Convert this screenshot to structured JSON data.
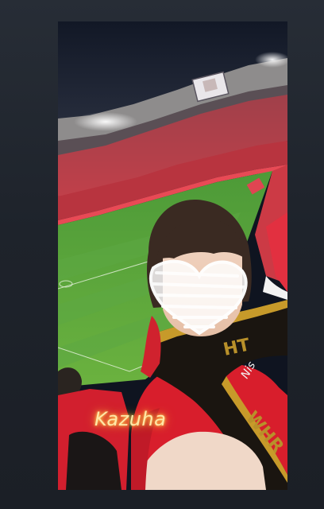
{
  "story": {
    "caption": "Kazuha",
    "caption_color": "#ffe8a8",
    "caption_glow_color": "#ffb83a",
    "background_color": "#1d2229"
  },
  "scene": {
    "jersey_text": "",
    "scarf_color": "#1a1510",
    "scarf_accent": "#c79a2a",
    "team_color": "#d81e2c",
    "pitch_color": "#59a43a",
    "sticker": "heart-scribble"
  }
}
